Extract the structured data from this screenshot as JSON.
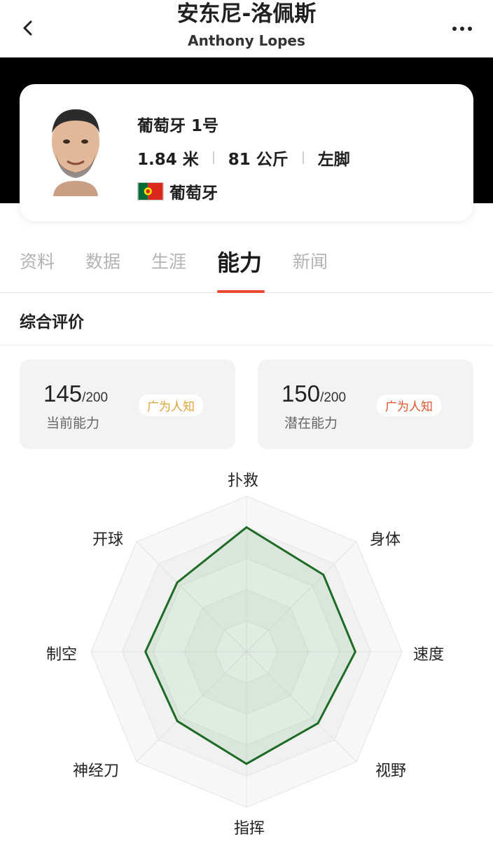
{
  "header": {
    "title_cn": "安东尼-洛佩斯",
    "title_en": "Anthony Lopes"
  },
  "player": {
    "team_number": "葡萄牙 1号",
    "height": "1.84 米",
    "weight": "81 公斤",
    "foot": "左脚",
    "country": "葡萄牙"
  },
  "tabs": [
    {
      "label": "资料"
    },
    {
      "label": "数据"
    },
    {
      "label": "生涯"
    },
    {
      "label": "能力"
    },
    {
      "label": "新闻"
    }
  ],
  "active_tab": "能力",
  "section": {
    "title": "综合评价"
  },
  "ratings": {
    "current": {
      "value": "145",
      "max": "/200",
      "label": "当前能力",
      "badge": "广为人知"
    },
    "potential": {
      "value": "150",
      "max": "/200",
      "label": "潜在能力",
      "badge": "广为人知"
    }
  },
  "radar": {
    "axes": [
      "扑救",
      "身体",
      "速度",
      "视野",
      "指挥",
      "神经刀",
      "制空",
      "开球"
    ],
    "values": [
      0.8,
      0.7,
      0.7,
      0.65,
      0.72,
      0.63,
      0.65,
      0.63
    ],
    "color": "#1e6b25"
  },
  "colors": {
    "accent": "#e84c2e",
    "badge_current": "#e2a23a",
    "badge_potential": "#e0532a"
  },
  "icons": {
    "back": "chevron-left-icon",
    "more": "more-dots-icon"
  }
}
